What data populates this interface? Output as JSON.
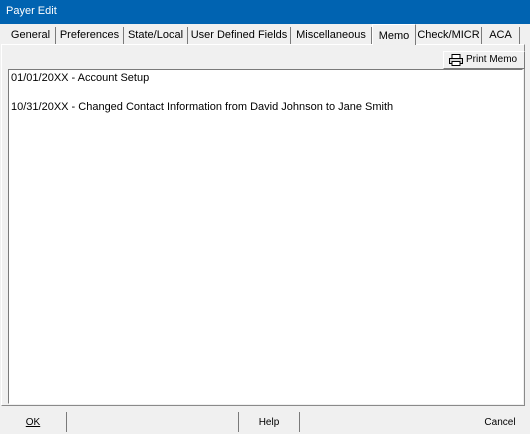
{
  "window": {
    "title": "Payer Edit"
  },
  "tabs": [
    {
      "label": "General"
    },
    {
      "label": "Preferences"
    },
    {
      "label": "State/Local"
    },
    {
      "label": "User Defined Fields"
    },
    {
      "label": "Miscellaneous"
    },
    {
      "label": "Memo",
      "active": true
    },
    {
      "label": "Check/MICR"
    },
    {
      "label": "ACA"
    }
  ],
  "toolbar": {
    "print_memo_label": "Print Memo",
    "print_memo_icon": "printer-icon"
  },
  "memo": {
    "lines": [
      "01/01/20XX - Account Setup",
      "10/31/20XX - Changed Contact Information from David Johnson to Jane Smith"
    ]
  },
  "footer": {
    "ok_label": "OK",
    "help_label": "Help",
    "cancel_label": "Cancel"
  }
}
